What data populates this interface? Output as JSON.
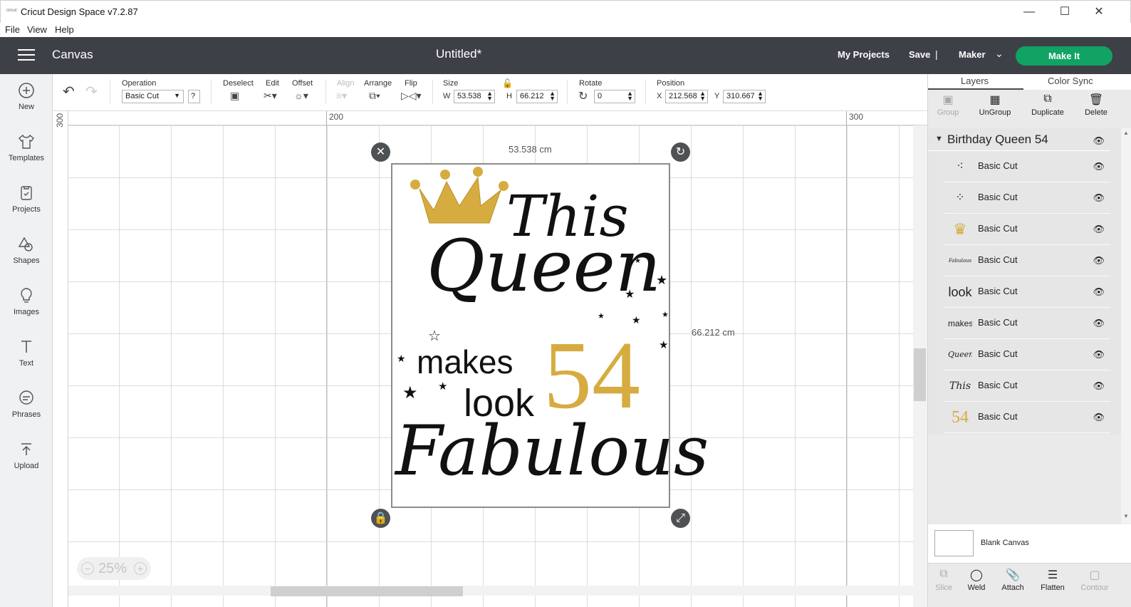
{
  "window": {
    "app_title": "Cricut Design Space  v7.2.87",
    "minimize": "—",
    "maximize": "☐",
    "close": "✕"
  },
  "menu": {
    "file": "File",
    "view": "View",
    "help": "Help"
  },
  "header": {
    "section": "Canvas",
    "document_title": "Untitled*",
    "my_projects": "My Projects",
    "save": "Save",
    "separator": "|",
    "machine": "Maker",
    "make_it": "Make It",
    "accent_color": "#10a364"
  },
  "sidebar": {
    "items": [
      {
        "label": "New",
        "icon": "plus-circle-icon"
      },
      {
        "label": "Templates",
        "icon": "shirt-icon"
      },
      {
        "label": "Projects",
        "icon": "projects-icon"
      },
      {
        "label": "Shapes",
        "icon": "shapes-icon"
      },
      {
        "label": "Images",
        "icon": "lightbulb-icon"
      },
      {
        "label": "Text",
        "icon": "text-icon"
      },
      {
        "label": "Phrases",
        "icon": "speech-bubble-icon"
      },
      {
        "label": "Upload",
        "icon": "upload-icon"
      }
    ]
  },
  "toolbar": {
    "operation_label": "Operation",
    "operation_value": "Basic Cut",
    "help": "?",
    "deselect": "Deselect",
    "edit": "Edit",
    "offset": "Offset",
    "align": "Align",
    "arrange": "Arrange",
    "flip": "Flip",
    "size_label": "Size",
    "w_label": "W",
    "w_value": "53.538",
    "h_label": "H",
    "h_value": "66.212",
    "rotate_label": "Rotate",
    "rotate_value": "0",
    "position_label": "Position",
    "x_label": "X",
    "x_value": "212.568",
    "y_label": "Y",
    "y_value": "310.667"
  },
  "canvas": {
    "ruler_top": [
      "200",
      "300"
    ],
    "ruler_left": [
      "300"
    ],
    "zoom": "25%",
    "zoom_minus": "−",
    "zoom_plus": "+",
    "width_dim": "53.538 cm",
    "height_dim": "66.212 cm",
    "design": {
      "line1": "This",
      "line2": "Queen",
      "line3": "makes",
      "line4": "look",
      "number": "54",
      "line5": "Fabulous",
      "gold_color": "#d6ac40"
    }
  },
  "layers_panel": {
    "tabs": [
      "Layers",
      "Color Sync"
    ],
    "actions": [
      {
        "label": "Group",
        "enabled": false
      },
      {
        "label": "UnGroup",
        "enabled": true
      },
      {
        "label": "Duplicate",
        "enabled": true
      },
      {
        "label": "Delete",
        "enabled": true
      }
    ],
    "group_name": "Birthday Queen 54",
    "layers": [
      {
        "thumb": "⁖",
        "name": "Basic Cut"
      },
      {
        "thumb": "⁘",
        "name": "Basic Cut"
      },
      {
        "thumb": "♛",
        "name": "Basic Cut"
      },
      {
        "thumb": "Fabulous",
        "name": "Basic Cut"
      },
      {
        "thumb": "look",
        "name": "Basic Cut"
      },
      {
        "thumb": "makes",
        "name": "Basic Cut"
      },
      {
        "thumb": "Queen",
        "name": "Basic Cut"
      },
      {
        "thumb": "This",
        "name": "Basic Cut"
      },
      {
        "thumb": "54",
        "name": "Basic Cut"
      }
    ],
    "blank_canvas": "Blank Canvas",
    "bottom_actions": [
      {
        "label": "Slice",
        "enabled": false
      },
      {
        "label": "Weld",
        "enabled": true
      },
      {
        "label": "Attach",
        "enabled": true
      },
      {
        "label": "Flatten",
        "enabled": true
      },
      {
        "label": "Contour",
        "enabled": false
      }
    ]
  }
}
